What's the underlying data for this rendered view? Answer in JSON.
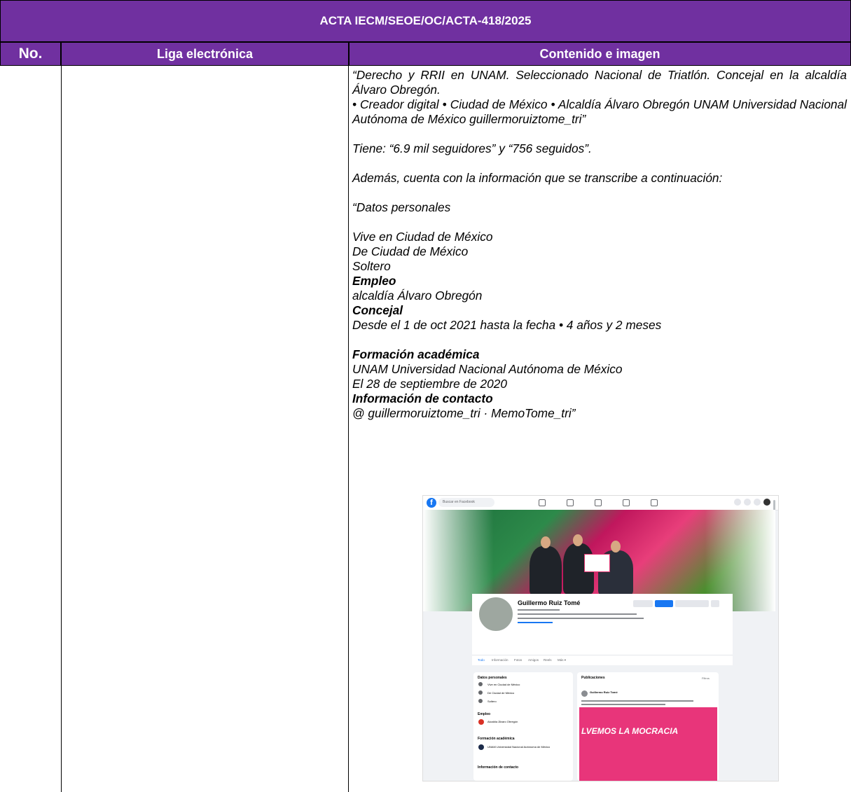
{
  "header": {
    "acta_title": "ACTA IECM/SEOE/OC/ACTA-418/2025",
    "col_no": "No.",
    "col_liga": "Liga electrónica",
    "col_contenido": "Contenido e imagen"
  },
  "content": {
    "bio_1": "“Derecho y RRII en UNAM. Seleccionado Nacional de Triatlón. Concejal en la alcaldía Álvaro Obregón.",
    "bio_2": "• Creador digital • Ciudad de México • Alcaldía Álvaro Obregón UNAM Universidad Nacional Autónoma de México guillermoruiztome_tri”",
    "followers": "Tiene: “6.9 mil seguidores” y “756 seguidos”.",
    "intro": "Además, cuenta con la información que se transcribe a continuación:",
    "datos_personales": "“Datos personales",
    "vive": "Vive en Ciudad de México",
    "de": "De Ciudad de México",
    "estado": "Soltero",
    "empleo_h": "Empleo",
    "empleo_lugar": "alcaldía Álvaro Obregón",
    "cargo": "Concejal",
    "periodo": "Desde el 1 de oct 2021 hasta la fecha • 4 años y 2 meses",
    "formacion_h": "Formación académica",
    "universidad": "UNAM Universidad Nacional Autónoma de México",
    "fecha": "El 28 de septiembre de 2020",
    "contacto_h": "Información de contacto",
    "contacto": "@ guillermoruiztome_tri · MemoTome_tri”"
  },
  "screenshot": {
    "search_placeholder": "Buscar en Facebook",
    "profile_name": "Guillermo Ruiz Tomé",
    "tabs": [
      "Todo",
      "Información",
      "Fotos",
      "Amigos",
      "Reels",
      "Más ▾"
    ],
    "datos_personales": "Datos personales",
    "vive": "Vive en Ciudad de México",
    "de": "De Ciudad de México",
    "estado": "Soltero",
    "empleo": "Empleo",
    "empleo_lugar": "Alcaldía Álvaro Obregón",
    "formacion": "Formación académica",
    "universidad": "UNAM Universidad Nacional Autónoma de México",
    "contacto": "Información de contacto",
    "publicaciones": "Publicaciones",
    "post_author": "Guillermo Ruiz Tomé",
    "post_image_text": "LVEMOS LA MOCRACIA",
    "filtros": "Filtros"
  },
  "colors": {
    "header_purple": "#7030a0",
    "facebook_blue": "#1877f2"
  }
}
